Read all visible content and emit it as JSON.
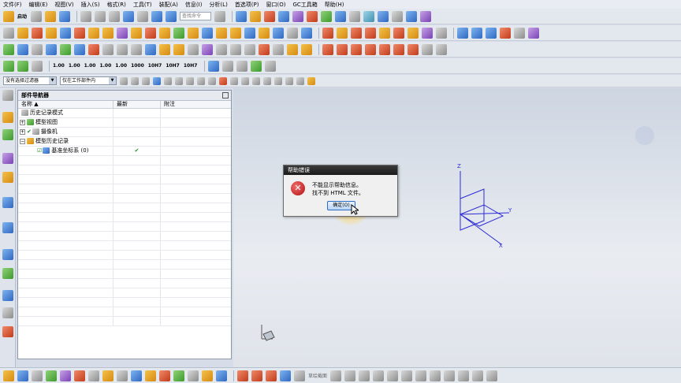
{
  "menubar": {
    "items": [
      "文件(F)",
      "编辑(E)",
      "视图(V)",
      "插入(S)",
      "格式(R)",
      "工具(T)",
      "装配(A)",
      "信息(I)",
      "分析(L)",
      "首选项(P)",
      "窗口(O)",
      "GC工具箱",
      "帮助(H)"
    ]
  },
  "toolbar": {
    "start_label": "启动",
    "search_placeholder": "查找命令",
    "size_buttons": [
      "1.00",
      "1.00",
      "1.00",
      "1.00",
      "1.00",
      "1000",
      "10H7",
      "10H7",
      "10H7"
    ],
    "filter_combo": "没有选择过滤器",
    "assembly_combo": "仅在工作部件内"
  },
  "nav": {
    "title": "部件导航器",
    "columns": [
      "名称",
      "最新",
      "附注"
    ],
    "rows": [
      {
        "label": "历史记录模式",
        "latest": ""
      },
      {
        "label": "模型视图",
        "latest": ""
      },
      {
        "label": "摄像机",
        "latest": ""
      },
      {
        "label": "模型历史记录",
        "latest": ""
      },
      {
        "label": "基准坐标系 (0)",
        "latest": "✔"
      }
    ]
  },
  "dialog": {
    "title": "帮助错误",
    "message_line1": "不能显示帮助信息。",
    "message_line2": "找不到 HTML 文件。",
    "ok_label": "确定(O)"
  },
  "axes": {
    "z": "Z",
    "y": "Y",
    "x": "X"
  },
  "bottom": {
    "label": "草绘截面"
  }
}
